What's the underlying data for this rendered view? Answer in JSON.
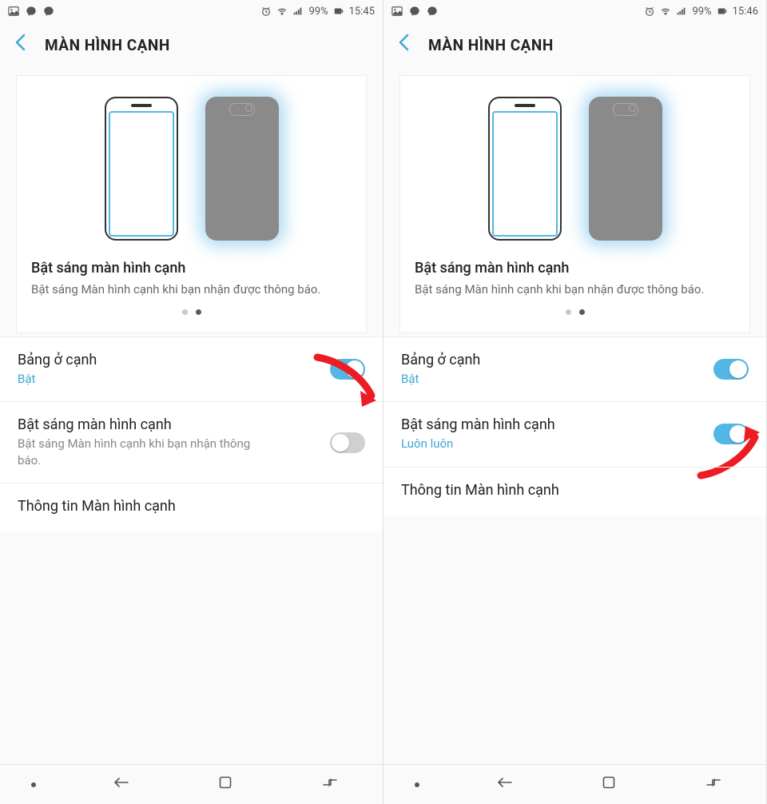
{
  "screens": [
    {
      "status": {
        "battery_text": "99%",
        "time": "15:45"
      },
      "header": {
        "title": "MÀN HÌNH CẠNH"
      },
      "hero": {
        "title": "Bật sáng màn hình cạnh",
        "desc": "Bật sáng Màn hình cạnh khi bạn nhận được thông báo."
      },
      "rows": [
        {
          "title": "Bảng ở cạnh",
          "sub": "Bật",
          "enabled": true,
          "toggle": "on"
        },
        {
          "title": "Bật sáng màn hình cạnh",
          "sub": "Bật sáng Màn hình cạnh khi bạn nhận thông báo.",
          "enabled": false,
          "toggle": "off"
        },
        {
          "title": "Thông tin Màn hình cạnh",
          "sub": "",
          "enabled": false,
          "toggle": null
        }
      ]
    },
    {
      "status": {
        "battery_text": "99%",
        "time": "15:46"
      },
      "header": {
        "title": "MÀN HÌNH CẠNH"
      },
      "hero": {
        "title": "Bật sáng màn hình cạnh",
        "desc": "Bật sáng Màn hình cạnh khi bạn nhận được thông báo."
      },
      "rows": [
        {
          "title": "Bảng ở cạnh",
          "sub": "Bật",
          "enabled": true,
          "toggle": "on"
        },
        {
          "title": "Bật sáng màn hình cạnh",
          "sub": "Luôn luôn",
          "enabled": true,
          "toggle": "on"
        },
        {
          "title": "Thông tin Màn hình cạnh",
          "sub": "",
          "enabled": false,
          "toggle": null
        }
      ]
    }
  ]
}
